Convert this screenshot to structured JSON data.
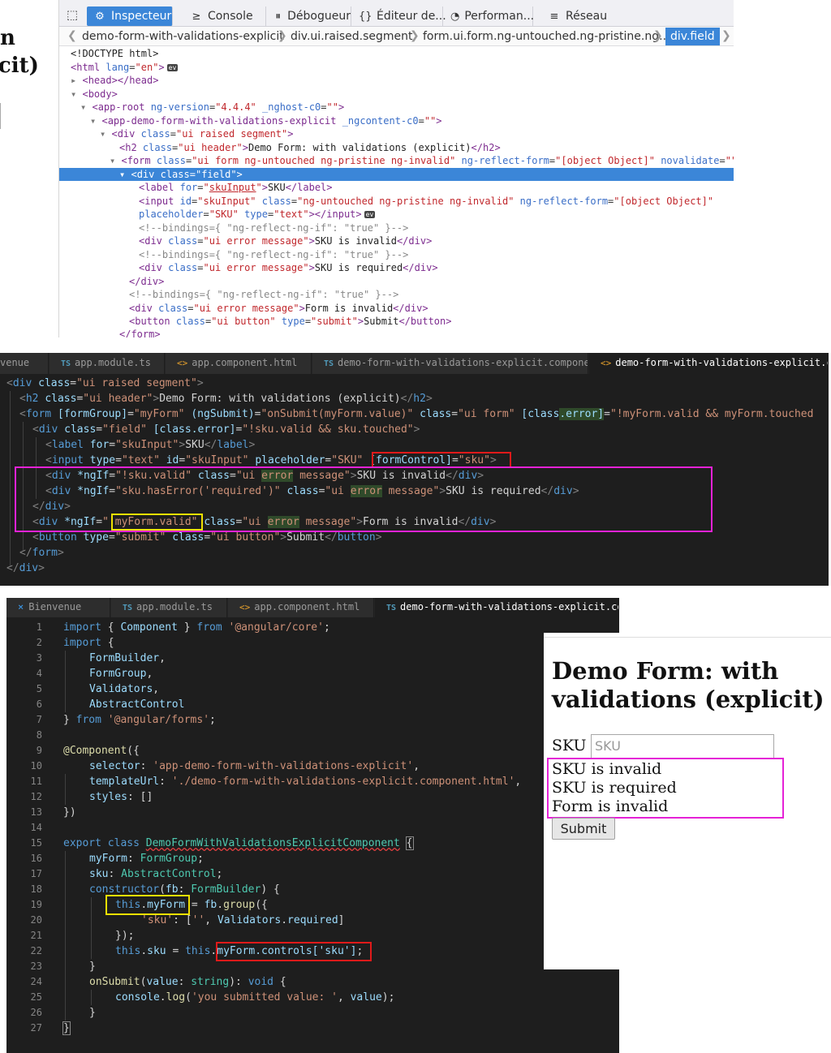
{
  "fragment": {
    "title_line1": "n",
    "title_line2": "icit)"
  },
  "devtools": {
    "tools": [
      {
        "name": "inspector",
        "label": "Inspecteur",
        "icon": "inspector-icon"
      },
      {
        "name": "console",
        "label": "Console",
        "icon": "console-icon"
      },
      {
        "name": "debugger",
        "label": "Débogueur",
        "icon": "debugger-icon"
      },
      {
        "name": "style-editor",
        "label": "Éditeur de...",
        "icon": "braces-icon"
      },
      {
        "name": "performance",
        "label": "Performan...",
        "icon": "performance-icon"
      },
      {
        "name": "network",
        "label": "Réseau",
        "icon": "network-icon"
      }
    ],
    "breadcrumb": [
      "demo-form-with-validations-explicit",
      "div.ui.raised.segment",
      "form.ui.form.ng-untouched.ng-pristine.ng...",
      "div.field"
    ],
    "tree": {
      "doctype": "<!DOCTYPE html>",
      "html_tag": "html",
      "lang_attr": "lang",
      "lang_val": "\"en\"",
      "head": "head",
      "body": "body",
      "approot_tag": "app-root",
      "ngversion_attr": "ng-version",
      "ngversion_val": "\"4.4.4\"",
      "nghost_attr": "_nghost-c0",
      "nghost_val": "\"\"",
      "appdemo_tag": "app-demo-form-with-validations-explicit",
      "ngcontent_attr": "_ngcontent-c0",
      "ngcontent_val": "\"\"",
      "div_tag": "div",
      "class_attr": "class",
      "segment_val": "\"ui raised segment\"",
      "h2_tag": "h2",
      "h2_class_val": "\"ui header\"",
      "h2_text": "Demo Form: with validations (explicit)",
      "form_tag": "form",
      "form_class_val": "\"ui form ng-untouched ng-pristine ng-invalid\"",
      "reflect_attr": "ng-reflect-form",
      "reflect_val": "\"[object Object]\"",
      "novalidate_attr": "novalidate",
      "novalidate_val": "\"\"",
      "field_val": "\"field\"",
      "label_tag": "label",
      "for_attr": "for",
      "for_val": "skuInput",
      "label_text": "SKU",
      "input_tag": "input",
      "id_attr": "id",
      "id_val": "\"skuInput\"",
      "input_class_val": "\"ng-untouched ng-pristine ng-invalid\"",
      "placeholder_attr": "placeholder",
      "placeholder_val": "\"SKU\"",
      "type_attr": "type",
      "type_text_val": "\"text\"",
      "comment": "<!--bindings={ \"ng-reflect-ng-if\": \"true\" }-->",
      "err_class_val": "\"ui error message\"",
      "err1": "SKU is invalid",
      "err2": "SKU is required",
      "err3": "Form is invalid",
      "button_tag": "button",
      "button_class_val": "\"ui button\"",
      "submit_val": "\"submit\"",
      "button_text": "Submit",
      "ev": "ev"
    }
  },
  "html_editor": {
    "tabs": [
      "venue",
      "app.module.ts",
      "app.component.html",
      "demo-form-with-validations-explicit.component.ts",
      "demo-form-with-validations-explicit.component"
    ],
    "lines": {
      "l1_tag": "div",
      "l1_attr": "class",
      "l1_val": "\"ui raised segment\"",
      "l2_tag": "h2",
      "l2_attr": "class",
      "l2_val": "\"ui header\"",
      "l2_text": "Demo Form: with validations (explicit)",
      "l3_tag": "form",
      "l3_fg_attr": "[formGroup]",
      "l3_fg_val": "\"myForm\"",
      "l3_sub_attr": "(ngSubmit)",
      "l3_sub_val": "\"onSubmit(myForm.value)\"",
      "l3_cls_attr": "class",
      "l3_cls_val": "\"ui form\"",
      "l3_ce_a": "[class",
      "l3_ce_b": ".error]",
      "l3_ce_val": "\"!myForm.valid && myForm.touched",
      "l4_tag": "div",
      "l4_attr": "class",
      "l4_val": "\"field\"",
      "l4_ce_attr": "[class.error]",
      "l4_ce_val": "\"!sku.valid && sku.touched\"",
      "l5_tag": "label",
      "l5_attr": "for",
      "l5_val": "\"skuInput\"",
      "l5_text": "SKU",
      "l6_tag": "input",
      "l6_type_attr": "type",
      "l6_type_val": "\"text\"",
      "l6_id_attr": "id",
      "l6_id_val": "\"skuInput\"",
      "l6_ph_attr": "placeholder",
      "l6_ph_val": "\"SKU\"",
      "l6_fc_attr": "[formControl]",
      "l6_fc_val": "\"sku\"",
      "l7_tag": "div",
      "l7_if_attr": "*ngIf",
      "l7_if_val": "\"!sku.valid\"",
      "l7_cls_attr": "class",
      "l7_cls_a": "\"ui ",
      "l7_cls_b": "error",
      "l7_cls_c": " message\"",
      "l7_text": "SKU is invalid",
      "l8_tag": "div",
      "l8_if_attr": "*ngIf",
      "l8_if_val": "\"sku.hasError('required')\"",
      "l8_cls_attr": "class",
      "l8_cls_a": "\"ui ",
      "l8_cls_b": "error",
      "l8_cls_c": " message\"",
      "l8_text": "SKU is required",
      "l9_tag": "div",
      "l10_tag": "div",
      "l10_if_attr": "*ngIf",
      "l10_if_q": "\"",
      "l10_if_val": "myForm.valid\"",
      "l10_cls_attr": "class",
      "l10_cls_a": "\"ui ",
      "l10_cls_b": "error",
      "l10_cls_c": " message\"",
      "l10_text": "Form is invalid",
      "l11_tag": "button",
      "l11_type_attr": "type",
      "l11_type_val": "\"submit\"",
      "l11_cls_attr": "class",
      "l11_cls_val": "\"ui button\"",
      "l11_text": "Submit",
      "l12_tag": "form",
      "l13_tag": "div"
    }
  },
  "ts_editor": {
    "tabs": [
      "Bienvenue",
      "app.module.ts",
      "app.component.html",
      "demo-form-with-validations-explicit.component.ts"
    ],
    "line_numbers": [
      "1",
      "2",
      "3",
      "4",
      "5",
      "6",
      "7",
      "8",
      "9",
      "10",
      "11",
      "12",
      "13",
      "14",
      "15",
      "16",
      "17",
      "18",
      "19",
      "20",
      "21",
      "22",
      "23",
      "24",
      "25",
      "26",
      "27"
    ],
    "code": {
      "import": "import",
      "from": "from",
      "export": "export",
      "class": "class",
      "this": "this",
      "void": "void",
      "component": "Component",
      "angular_core": "'@angular/core'",
      "angular_forms": "'@angular/forms'",
      "formbuilder": "FormBuilder",
      "formgroup": "FormGroup",
      "validators": "Validators",
      "abstractcontrol": "AbstractControl",
      "decorator": "@Component",
      "selector": "selector",
      "selector_val": "'app-demo-form-with-validations-explicit'",
      "templateurl": "templateUrl",
      "templateurl_val": "'./demo-form-with-validations-explicit.component.html'",
      "styles": "styles",
      "classname": "DemoFormWithValidationsExplicitComponent",
      "myform": "myForm",
      "sku": "sku",
      "constructor": "constructor",
      "fb": "fb",
      "group": "group",
      "sku_key": "'sku'",
      "empty_str": "''",
      "required": "required",
      "controls": "myForm.controls['sku']",
      "onsubmit": "onSubmit",
      "value": "value",
      "string": "string",
      "console": "console",
      "log": "log",
      "log_msg": "'you submitted value: '"
    }
  },
  "form_preview": {
    "title": "Demo Form: with validations (explicit)",
    "sku_label": "SKU",
    "sku_placeholder": "SKU",
    "errors": [
      "SKU is invalid",
      "SKU is required",
      "Form is invalid"
    ],
    "submit_label": "Submit"
  },
  "colors": {
    "highlight_red": "#e01a1a",
    "highlight_yellow": "#f0e000",
    "highlight_magenta": "#e522d6",
    "devtools_accent": "#3b86d8"
  }
}
